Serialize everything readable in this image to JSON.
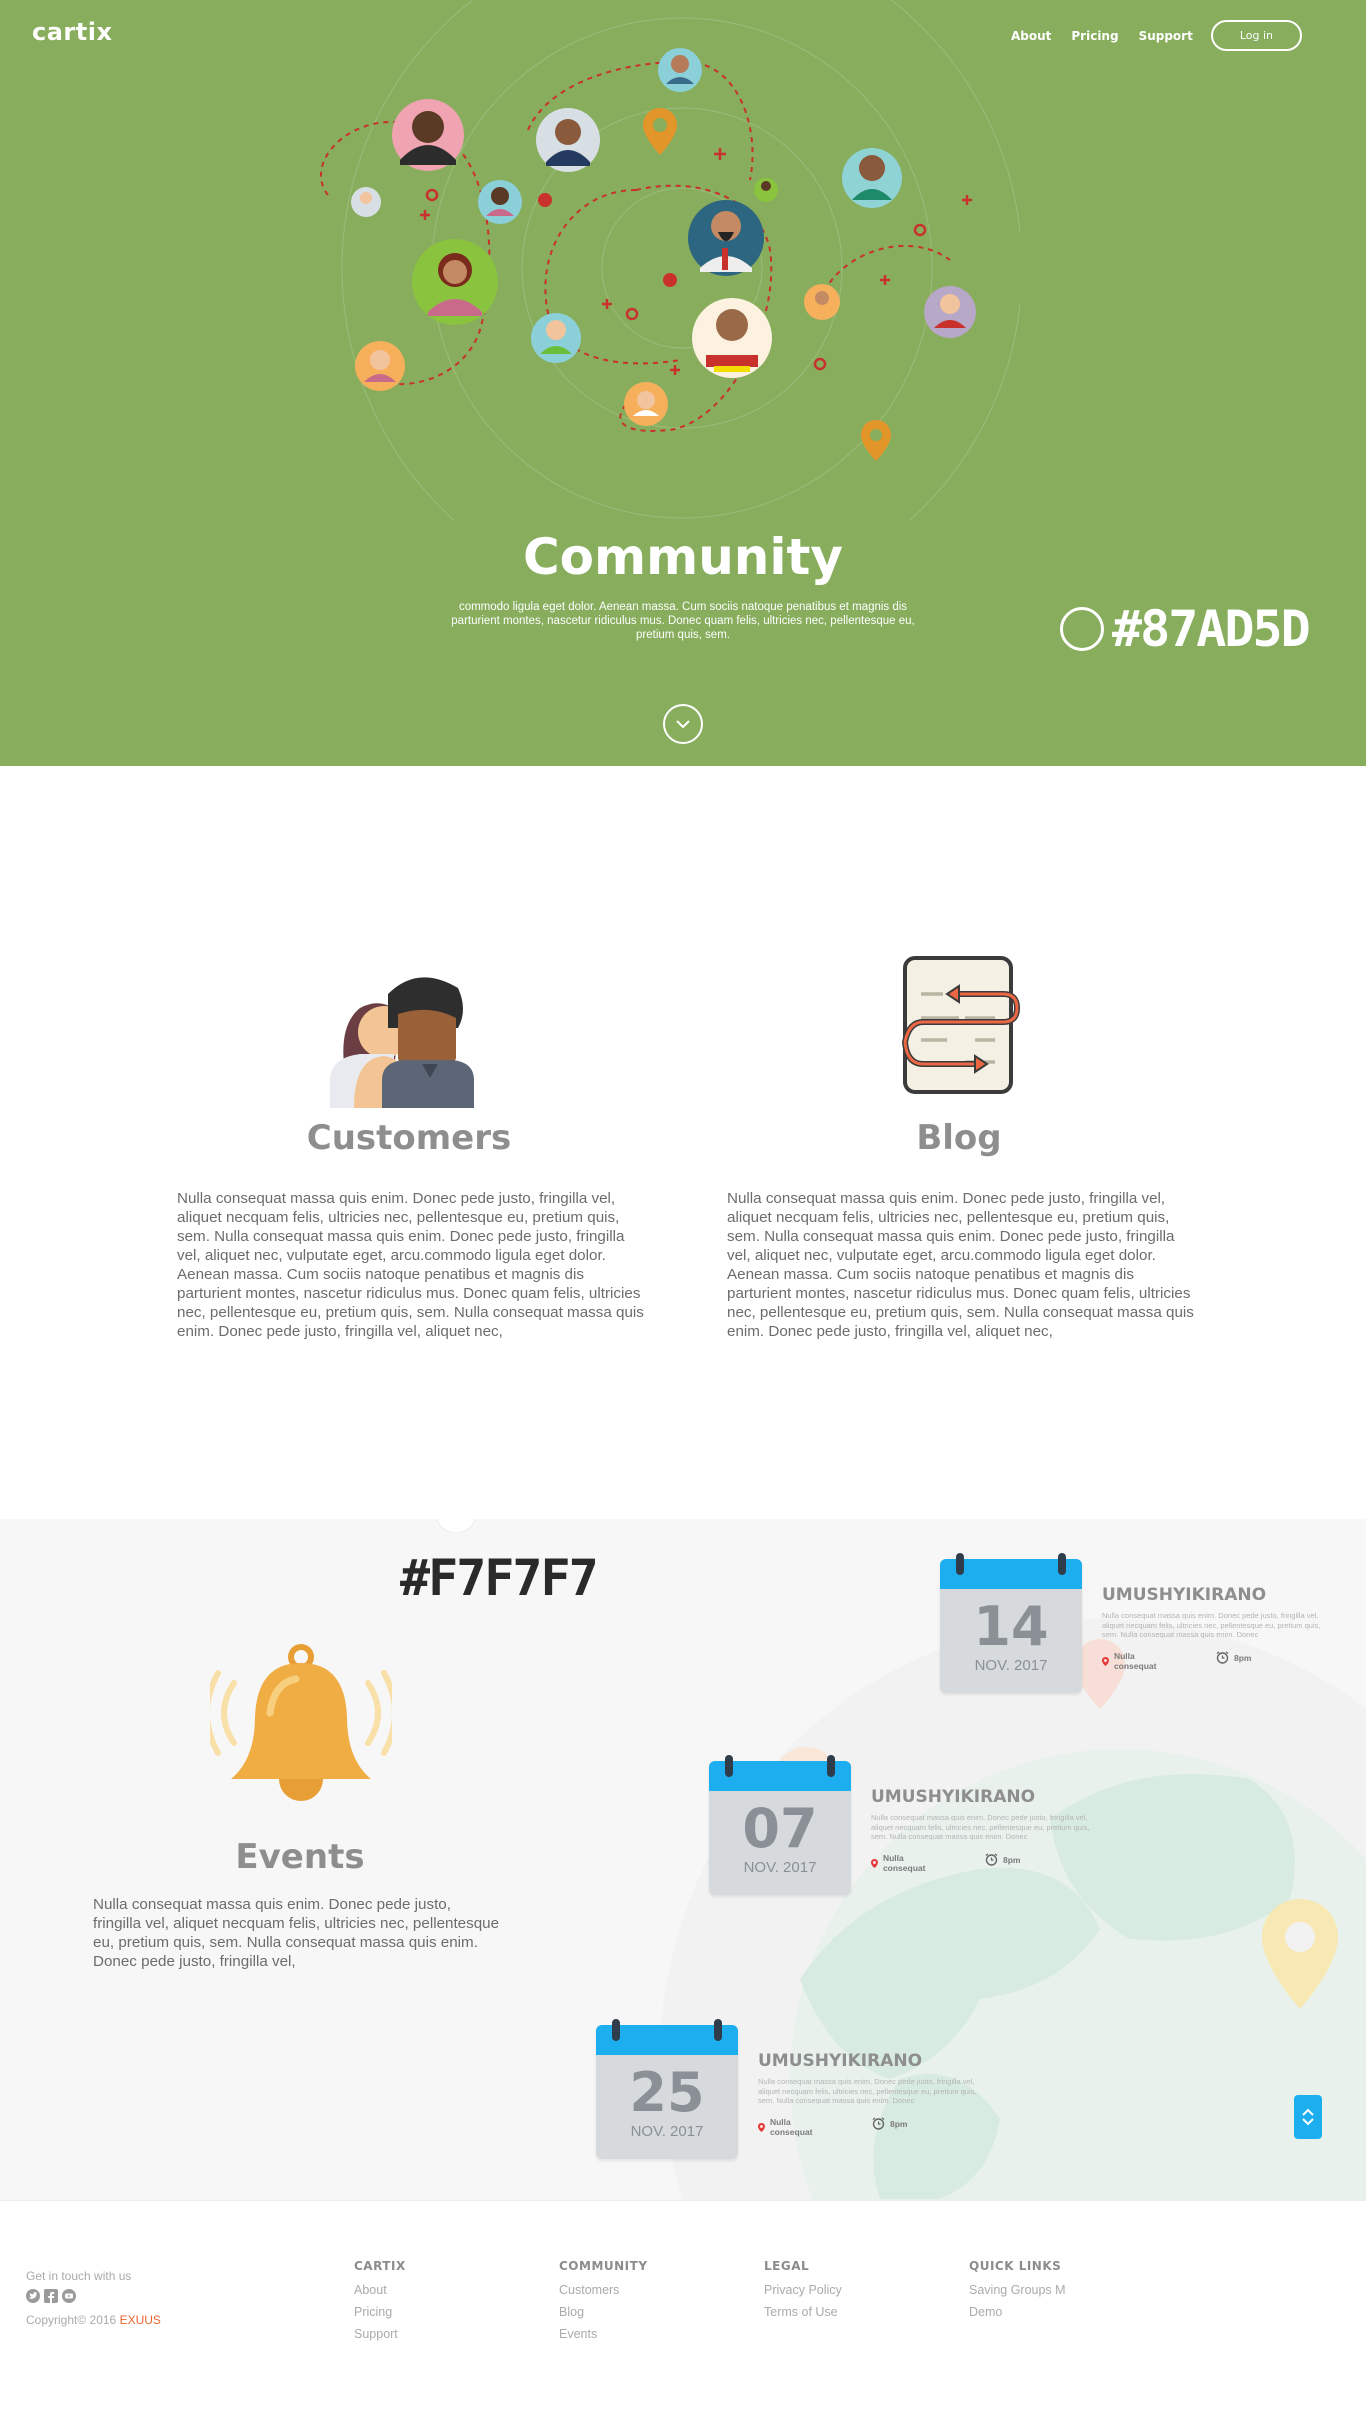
{
  "header": {
    "logo": "cartix",
    "nav": [
      "About",
      "Pricing",
      "Support"
    ],
    "login_label": "Log in"
  },
  "hero": {
    "title": "Community",
    "subtitle": "commodo ligula eget dolor. Aenean massa. Cum sociis natoque penatibus et magnis dis parturient montes, nascetur ridiculus mus. Donec quam felis, ultricies nec, pellentesque eu, pretium quis, sem.",
    "color_label": "#87AD5D",
    "scroll_icon": "chevron-down-icon"
  },
  "features": [
    {
      "title": "Customers",
      "icon": "customers-icon",
      "text": "Nulla consequat massa quis enim. Donec pede justo, fringilla vel, aliquet necquam felis, ultricies nec, pellentesque eu, pretium quis, sem. Nulla consequat massa quis enim. Donec pede justo, fringilla vel, aliquet nec, vulputate eget, arcu.commodo ligula eget dolor. Aenean massa. Cum sociis natoque penatibus et magnis dis parturient montes, nascetur ridiculus mus. Donec quam felis, ultricies nec, pellentesque eu, pretium quis, sem. Nulla consequat massa quis enim. Donec pede justo, fringilla vel, aliquet nec,"
    },
    {
      "title": "Blog",
      "icon": "blog-icon",
      "text": "Nulla consequat massa quis enim. Donec pede justo, fringilla vel, aliquet necquam felis, ultricies nec, pellentesque eu, pretium quis, sem. Nulla consequat massa quis enim. Donec pede justo, fringilla vel, aliquet nec, vulputate eget, arcu.commodo ligula eget dolor. Aenean massa. Cum sociis natoque penatibus et magnis dis parturient montes, nascetur ridiculus mus. Donec quam felis, ultricies nec, pellentesque eu, pretium quis, sem. Nulla consequat massa quis enim. Donec pede justo, fringilla vel, aliquet nec,"
    }
  ],
  "events": {
    "color_label": "#F7F7F7",
    "title": "Events",
    "icon": "bell-icon",
    "text": "Nulla consequat massa quis enim. Donec pede justo, fringilla vel, aliquet necquam felis, ultricies nec, pellentesque eu, pretium quis, sem. Nulla consequat massa quis enim. Donec pede justo, fringilla vel,",
    "items": [
      {
        "day": "14",
        "month": "NOV. 2017",
        "title": "UMUSHYIKIRANO",
        "desc": "Nulla consequat massa quis enim. Donec pede justo, fringilla vel, aliquet necquam felis, ultricies nec, pellentesque eu, pretium quis, sem. Nulla consequat massa quis enim. Donec",
        "location": "Nulla consequat",
        "time": "8pm"
      },
      {
        "day": "07",
        "month": "NOV. 2017",
        "title": "UMUSHYIKIRANO",
        "desc": "Nulla consequat massa quis enim. Donec pede justo, fringilla vel, aliquet necquam felis, ultricies nec, pellentesque eu, pretium quis, sem. Nulla consequat massa quis enim. Donec",
        "location": "Nulla consequat",
        "time": "8pm"
      },
      {
        "day": "25",
        "month": "NOV. 2017",
        "title": "UMUSHYIKIRANO",
        "desc": "Nulla consequat massa quis enim. Donec pede justo, fringilla vel, aliquet necquam felis, ultricies nec, pellentesque eu, pretium quis, sem. Nulla consequat massa quis enim. Donec",
        "location": "Nulla consequat",
        "time": "8pm"
      }
    ]
  },
  "footer": {
    "contact_label": "Get in touch with us",
    "social_icons": [
      "twitter-icon",
      "facebook-icon",
      "youtube-icon"
    ],
    "copyright": "Copyright© 2016",
    "copyright_brand": "EXUUS",
    "columns": [
      {
        "heading": "CARTIX",
        "links": [
          "About",
          "Pricing",
          "Support"
        ]
      },
      {
        "heading": "COMMUNITY",
        "links": [
          "Customers",
          "Blog",
          "Events"
        ]
      },
      {
        "heading": "LEGAL",
        "links": [
          "Privacy Policy",
          "Terms of Use"
        ]
      },
      {
        "heading": "QUICK LINKS",
        "links": [
          "Saving Groups M",
          "Demo"
        ]
      }
    ]
  },
  "colors": {
    "hero_bg": "#87AD5D",
    "events_bg": "#F7F7F7",
    "accent_blue": "#1daeef",
    "accent_red": "#d62b2b",
    "brand_orange": "#f0662f",
    "bell": "#f0ad44"
  }
}
